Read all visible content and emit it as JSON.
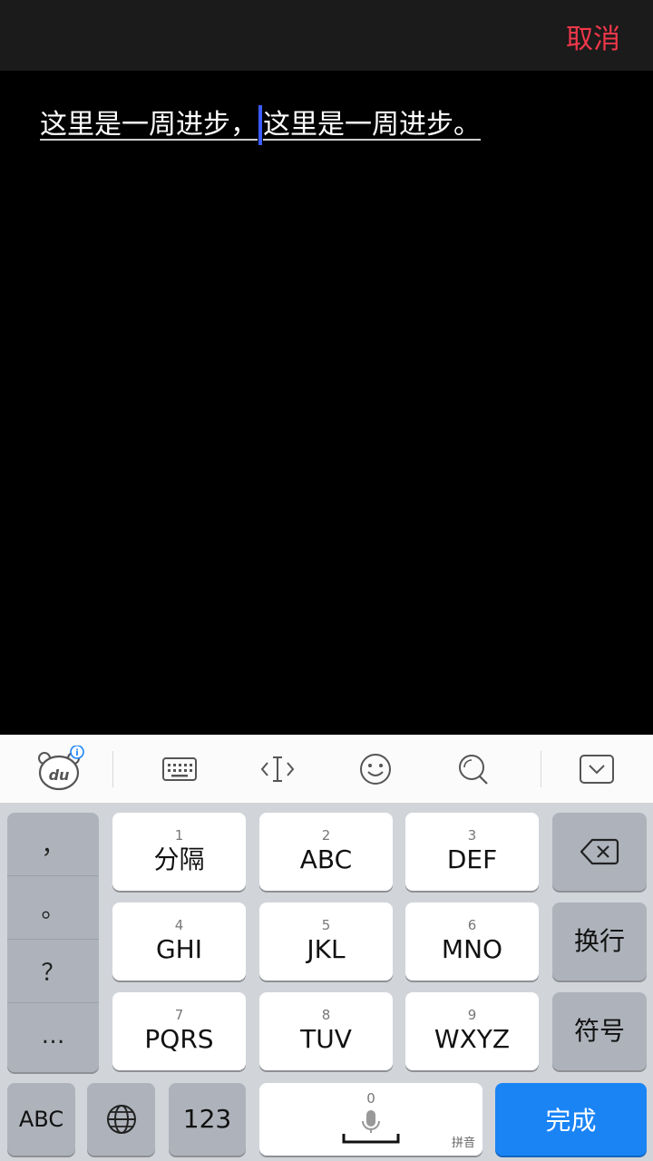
{
  "header": {
    "cancel_label": "取消"
  },
  "editor": {
    "text_before": "这里是一周进步，",
    "text_after": "这里是一周进步。"
  },
  "toolbar": {
    "icons": [
      "du-bear-logo-icon",
      "keyboard-icon",
      "cursor-move-icon",
      "emoji-icon",
      "search-icon",
      "collapse-keyboard-icon"
    ]
  },
  "keyboard": {
    "punct": [
      "，",
      "。",
      "？",
      "…"
    ],
    "keys": [
      {
        "num": "1",
        "label": "分隔"
      },
      {
        "num": "2",
        "label": "ABC"
      },
      {
        "num": "3",
        "label": "DEF"
      },
      {
        "num": "4",
        "label": "GHI"
      },
      {
        "num": "5",
        "label": "JKL"
      },
      {
        "num": "6",
        "label": "MNO"
      },
      {
        "num": "7",
        "label": "PQRS"
      },
      {
        "num": "8",
        "label": "TUV"
      },
      {
        "num": "9",
        "label": "WXYZ"
      }
    ],
    "side_keys": {
      "delete_icon": "backspace-icon",
      "newline": "换行",
      "symbols": "符号"
    },
    "bottom": {
      "abc": "ABC",
      "globe_icon": "globe-icon",
      "num123": "123",
      "space_num": "0",
      "space_mic_icon": "mic-icon",
      "space_label": "拼音",
      "done": "完成"
    }
  },
  "colors": {
    "cancel": "#f0374a",
    "caret": "#3b5bff",
    "done_key": "#1a84f5"
  }
}
